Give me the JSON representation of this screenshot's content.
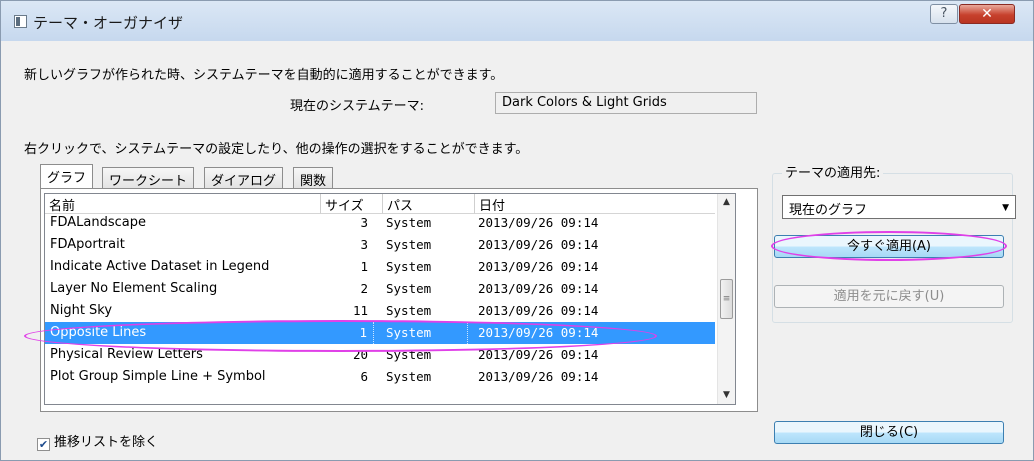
{
  "window": {
    "title": "テーマ・オーガナイザ",
    "help_label": "?",
    "close_label": "✕"
  },
  "description": "新しいグラフが作られた時、システムテーマを自動的に適用することができます。",
  "current_theme": {
    "label": "現在のシステムテーマ:",
    "value": "Dark Colors & Light Grids"
  },
  "instruction": "右クリックで、システムテーマの設定したり、他の操作の選択をすることができます。",
  "tabs": [
    {
      "label": "グラフ",
      "active": true
    },
    {
      "label": "ワークシート",
      "active": false
    },
    {
      "label": "ダイアログ",
      "active": false
    },
    {
      "label": "関数",
      "active": false
    }
  ],
  "list": {
    "columns": [
      "名前",
      "サイズ",
      "パス",
      "日付"
    ],
    "rows": [
      {
        "name": "FDALandscape",
        "size": "3",
        "path": "System",
        "date": "2013/09/26 09:14",
        "selected": false
      },
      {
        "name": "FDAportrait",
        "size": "3",
        "path": "System",
        "date": "2013/09/26 09:14",
        "selected": false
      },
      {
        "name": "Indicate Active Dataset in Legend",
        "size": "1",
        "path": "System",
        "date": "2013/09/26 09:14",
        "selected": false
      },
      {
        "name": "Layer No Element Scaling",
        "size": "2",
        "path": "System",
        "date": "2013/09/26 09:14",
        "selected": false
      },
      {
        "name": "Night Sky",
        "size": "11",
        "path": "System",
        "date": "2013/09/26 09:14",
        "selected": false
      },
      {
        "name": "Opposite Lines",
        "size": "1",
        "path": "System",
        "date": "2013/09/26 09:14",
        "selected": true
      },
      {
        "name": "Physical Review Letters",
        "size": "20",
        "path": "System",
        "date": "2013/09/26 09:14",
        "selected": false
      },
      {
        "name": "Plot Group Simple Line + Symbol",
        "size": "6",
        "path": "System",
        "date": "2013/09/26 09:14",
        "selected": false
      }
    ]
  },
  "exclude_checkbox": {
    "label": "推移リストを除く",
    "checked": true
  },
  "apply_group": {
    "label": "テーマの適用先:",
    "target": "現在のグラフ",
    "apply_now_label": "今すぐ適用(A)",
    "undo_label": "適用を元に戻す(U)"
  },
  "close_button_label": "閉じる(C)",
  "colors": {
    "selection": "#3399ff",
    "highlight_ring": "#e040e8"
  }
}
